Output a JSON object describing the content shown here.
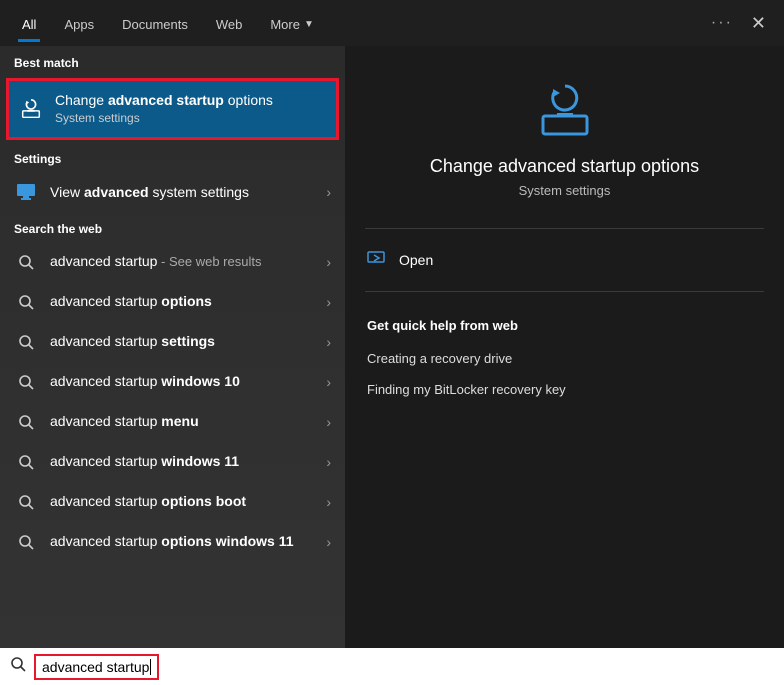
{
  "topbar": {
    "tabs": [
      "All",
      "Apps",
      "Documents",
      "Web",
      "More"
    ],
    "active_tab": 0
  },
  "sections": {
    "best_match": "Best match",
    "settings": "Settings",
    "search_web": "Search the web"
  },
  "best_match_item": {
    "title_pre": "Change ",
    "title_bold": "advanced startup",
    "title_post": " options",
    "subtitle": "System settings"
  },
  "settings_item": {
    "pre": "View ",
    "bold": "advanced",
    "post": " system settings"
  },
  "web_items": [
    {
      "pre": "advanced startup",
      "bold": "",
      "post": "",
      "suffix": " - See web results"
    },
    {
      "pre": "advanced startup ",
      "bold": "options",
      "post": "",
      "suffix": ""
    },
    {
      "pre": "advanced startup ",
      "bold": "settings",
      "post": "",
      "suffix": ""
    },
    {
      "pre": "advanced startup ",
      "bold": "windows 10",
      "post": "",
      "suffix": ""
    },
    {
      "pre": "advanced startup ",
      "bold": "menu",
      "post": "",
      "suffix": ""
    },
    {
      "pre": "advanced startup ",
      "bold": "windows 11",
      "post": "",
      "suffix": ""
    },
    {
      "pre": "advanced startup ",
      "bold": "options boot",
      "post": "",
      "suffix": ""
    },
    {
      "pre": "advanced startup ",
      "bold": "options windows 11",
      "post": "",
      "suffix": ""
    }
  ],
  "preview": {
    "title": "Change advanced startup options",
    "subtitle": "System settings",
    "open_label": "Open",
    "quick_help_header": "Get quick help from web",
    "quick_links": [
      "Creating a recovery drive",
      "Finding my BitLocker recovery key"
    ]
  },
  "search": {
    "query": "advanced startup"
  },
  "colors": {
    "accent": "#0078d4",
    "highlight_bg": "#0b5a8a",
    "annotation": "#e8172e"
  }
}
